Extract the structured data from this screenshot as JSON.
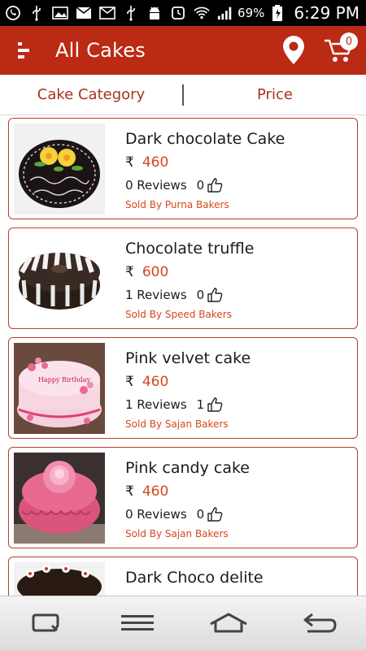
{
  "status_bar": {
    "battery": "69",
    "battery_unit": "%",
    "time": "6:29 PM",
    "icons": [
      "whatsapp-icon",
      "usb-icon",
      "gallery-icon",
      "gmail-icon",
      "email-icon",
      "usb-icon",
      "android-debug-icon",
      "alarm-icon",
      "wifi-icon",
      "signal-icon",
      "battery-charging-icon"
    ]
  },
  "app_bar": {
    "title": "All Cakes",
    "cart_count": "0",
    "color": "#bb2a14"
  },
  "filters": {
    "category_label": "Cake Category",
    "price_label": "Price"
  },
  "currency_symbol": "₹",
  "products": [
    {
      "name": "Dark chocolate Cake",
      "price": "460",
      "reviews": "0 Reviews",
      "likes": "0",
      "seller": "Sold By Purna Bakers"
    },
    {
      "name": "Chocolate truffle",
      "price": "600",
      "reviews": "1 Reviews",
      "likes": "0",
      "seller": "Sold By Speed Bakers"
    },
    {
      "name": "Pink velvet cake",
      "price": "460",
      "reviews": "1 Reviews",
      "likes": "1",
      "seller": "Sold By Sajan Bakers"
    },
    {
      "name": "Pink candy cake",
      "price": "460",
      "reviews": "0 Reviews",
      "likes": "0",
      "seller": "Sold By Sajan Bakers"
    },
    {
      "name": "Dark Choco delite",
      "price": "",
      "reviews": "",
      "likes": "",
      "seller": ""
    }
  ],
  "colors": {
    "accent": "#bb2a14",
    "price": "#d5471f",
    "card_border": "#b8402c"
  }
}
